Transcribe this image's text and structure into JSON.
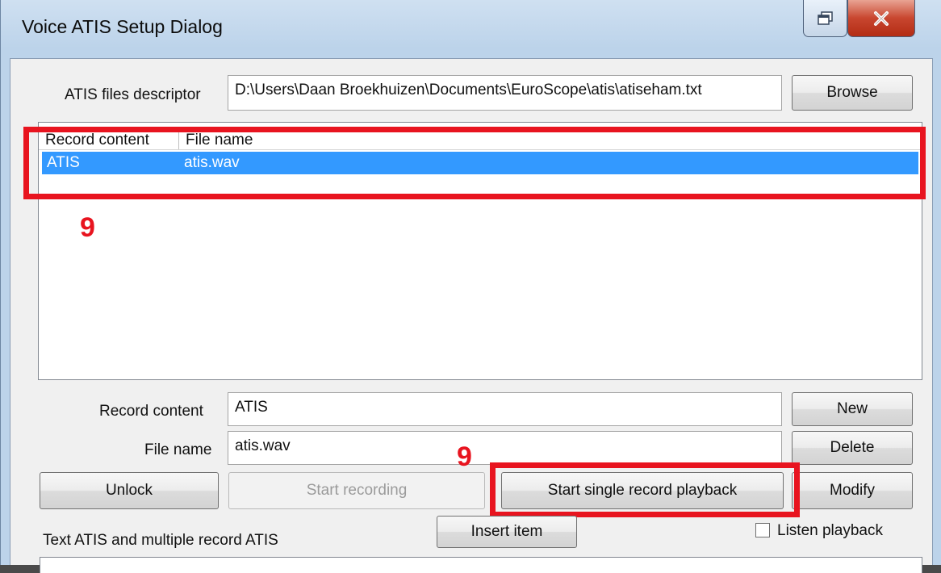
{
  "window": {
    "title": "Voice ATIS Setup Dialog"
  },
  "caption_buttons": {
    "restore_icon": "restore-icon",
    "close_icon": "close-icon"
  },
  "descriptor": {
    "label": "ATIS files descriptor",
    "value": "D:\\Users\\Daan Broekhuizen\\Documents\\EuroScope\\atis\\atiseham.txt",
    "browse": "Browse"
  },
  "list": {
    "columns": [
      "Record content",
      "File name"
    ],
    "rows": [
      {
        "record_content": "ATIS",
        "file_name": "atis.wav",
        "selected": true
      }
    ]
  },
  "record_content": {
    "label": "Record content",
    "value": "ATIS"
  },
  "file_name": {
    "label": "File name",
    "value": "atis.wav"
  },
  "buttons": {
    "new": "New",
    "delete": "Delete",
    "modify": "Modify",
    "unlock": "Unlock",
    "start_recording": "Start recording",
    "start_single_playback": "Start single record playback",
    "insert_item": "Insert item"
  },
  "text_atis_label": "Text ATIS and multiple record ATIS",
  "listen_playback": {
    "label": "Listen playback",
    "checked": false
  },
  "annotations": {
    "list_marker": "9",
    "playback_marker": "9",
    "color": "#e8141f"
  },
  "colors": {
    "selection": "#3399ff"
  }
}
